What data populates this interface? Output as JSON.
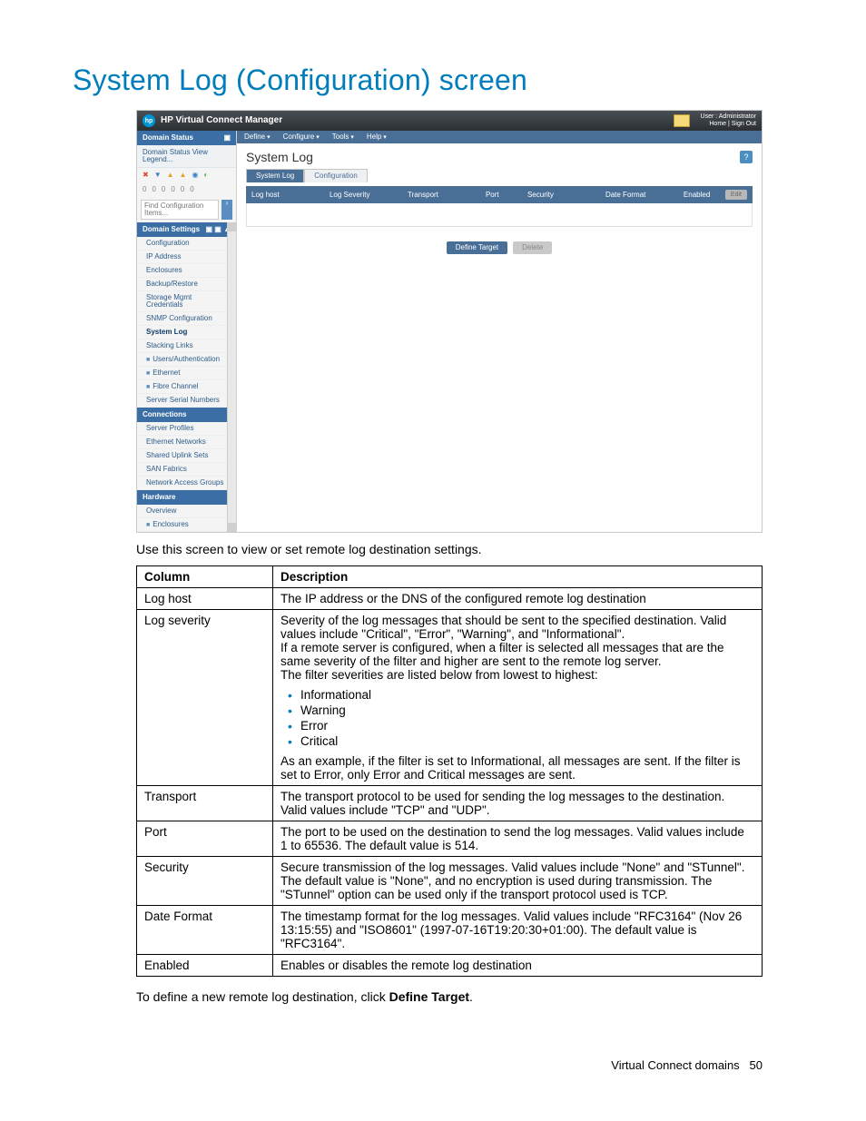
{
  "page": {
    "heading": "System Log (Configuration) screen",
    "intro": "Use this screen to view or set remote log destination settings.",
    "define_line_pre": "To define a new remote log destination, click ",
    "define_line_bold": "Define Target",
    "define_line_post": ".",
    "footer_text": "Virtual Connect domains",
    "footer_page": "50"
  },
  "app": {
    "title": "HP Virtual Connect Manager",
    "user_label": "User : Administrator",
    "user_links": "Home | Sign Out",
    "menubar": [
      "Define",
      "Configure",
      "Tools",
      "Help"
    ],
    "pane_title": "System Log",
    "tabs": {
      "a": "System Log",
      "b": "Configuration"
    },
    "grid_cols": [
      "Log host",
      "Log Severity",
      "Transport",
      "Port",
      "Security",
      "Date Format",
      "Enabled"
    ],
    "grid_edit": "Edit",
    "btn_define": "Define Target",
    "btn_delete": "Delete",
    "sidebar": {
      "domain_status": "Domain Status",
      "domain_status_sub": "Domain Status    View Legend...",
      "filter_placeholder": "Find Configuration Items...",
      "domain_settings": "Domain Settings",
      "items1": [
        "Configuration",
        "IP Address",
        "Enclosures",
        "Backup/Restore",
        "Storage Mgmt Credentials",
        "SNMP Configuration"
      ],
      "system_log": "System Log",
      "items2": [
        "Stacking Links"
      ],
      "box_items": [
        "Users/Authentication",
        "Ethernet",
        "Fibre Channel"
      ],
      "items3": [
        "Server Serial Numbers"
      ],
      "connections": "Connections",
      "conn_items": [
        "Server Profiles",
        "Ethernet Networks",
        "Shared Uplink Sets",
        "SAN Fabrics",
        "Network Access Groups"
      ],
      "hardware": "Hardware",
      "hw_items": [
        "Overview"
      ],
      "hw_box": "Enclosures"
    }
  },
  "table": {
    "head_col": "Column",
    "head_desc": "Description",
    "rows": {
      "log_host": {
        "c": "Log host",
        "d": "The IP address or the DNS of the configured remote log destination"
      },
      "log_severity": {
        "c": "Log severity",
        "d_intro": "Severity of the log messages that should be sent to the specified destination. Valid values include \"Critical\", \"Error\", \"Warning\", and \"Informational\".\nIf a remote server is configured, when a filter is selected all messages that are the same severity of the filter and higher are sent to the remote log server.\nThe filter severities are listed below from lowest to highest:",
        "levels": [
          "Informational",
          "Warning",
          "Error",
          "Critical"
        ],
        "d_outro": "As an example, if the filter is set to Informational, all messages are sent. If the filter is set to Error, only Error and Critical messages are sent."
      },
      "transport": {
        "c": "Transport",
        "d": "The transport protocol to be used for sending the log messages to the destination. Valid values include \"TCP\" and \"UDP\"."
      },
      "port": {
        "c": "Port",
        "d": "The port to be used on the destination to send the log messages. Valid values include 1 to 65536. The default value is 514."
      },
      "security": {
        "c": "Security",
        "d": "Secure transmission of the log messages. Valid values include \"None\" and \"STunnel\". The default value is \"None\", and no encryption is used during transmission. The \"STunnel\" option can be used only if the transport protocol used is TCP."
      },
      "date_format": {
        "c": "Date Format",
        "d": "The timestamp format for the log messages. Valid values include \"RFC3164\" (Nov 26 13:15:55) and \"ISO8601\" (1997-07-16T19:20:30+01:00). The default value is \"RFC3164\"."
      },
      "enabled": {
        "c": "Enabled",
        "d": "Enables or disables the remote log destination"
      }
    }
  }
}
